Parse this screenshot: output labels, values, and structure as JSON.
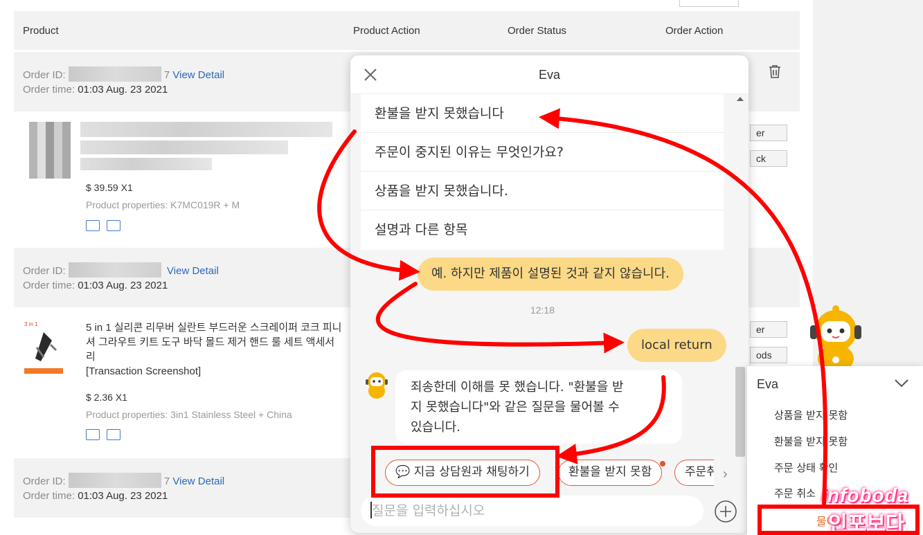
{
  "table_header": {
    "product": "Product",
    "product_action": "Product Action",
    "order_status": "Order Status",
    "order_action": "Order Action"
  },
  "orders": [
    {
      "id_label": "Order ID: ",
      "id_tail": "7",
      "view_detail": "View Detail",
      "time_label": "Order time: ",
      "time_value": "01:03 Aug. 23 2021",
      "price": "$ 39.59 X1",
      "properties": "Product properties: K7MC019R + M"
    },
    {
      "id_label": "Order ID: ",
      "id_tail": "",
      "view_detail": "View Detail",
      "time_label": "Order time: ",
      "time_value": "01:03 Aug. 23 2021",
      "product_title": "5 in 1 실리콘 리무버 실란트 부드러운 스크레이퍼 코크 피니셔 그라우트 키트 도구 바닥 몰드 제거 핸드 룰 세트 액세서리",
      "product_note": "[Transaction Screenshot]",
      "price": "$ 2.36 X1",
      "properties": "Product properties: 3in1 Stainless Steel + China"
    },
    {
      "id_label": "Order ID: ",
      "id_tail": "7",
      "view_detail": "View Detail",
      "time_label": "Order time: ",
      "time_value": "01:03 Aug. 23 2021"
    }
  ],
  "side_buttons": [
    "er",
    "ck",
    "er",
    "ods"
  ],
  "chat": {
    "title": "Eva",
    "menu": [
      "환불을 받지 못했습니다",
      "주문이 중지된 이유는 무엇인가요?",
      "상품을 받지 못했습니다.",
      "설명과 다른 항목"
    ],
    "user_msg_1": "예. 하지만 제품이 설명된 것과 같지 않습니다.",
    "time": "12:18",
    "user_msg_2": "local return",
    "bot_lines": [
      "죄송한데 이해를 못 했습니다. \"환불을 받",
      "지 못했습니다\"와 같은 질문을 물어볼 수",
      "있습니다."
    ],
    "chips": [
      "💬 지금 상담원과 채팅하기",
      "환불을 받지 못함",
      "주문취소"
    ],
    "input_placeholder": "질문을 입력하십시오"
  },
  "popup": {
    "title": "Eva",
    "items": [
      "상품을 받지 못함",
      "환불을 받지 못함",
      "주문 상태 확인",
      "주문 취소"
    ],
    "ask": "물어봐"
  },
  "watermark": {
    "line1": "infoboda",
    "line2": "인포보다"
  },
  "colors": {
    "accent_red": "#ff0000",
    "user_bubble": "#fcd986",
    "chip_border": "#e0563b",
    "link_blue": "#2d67b8"
  }
}
